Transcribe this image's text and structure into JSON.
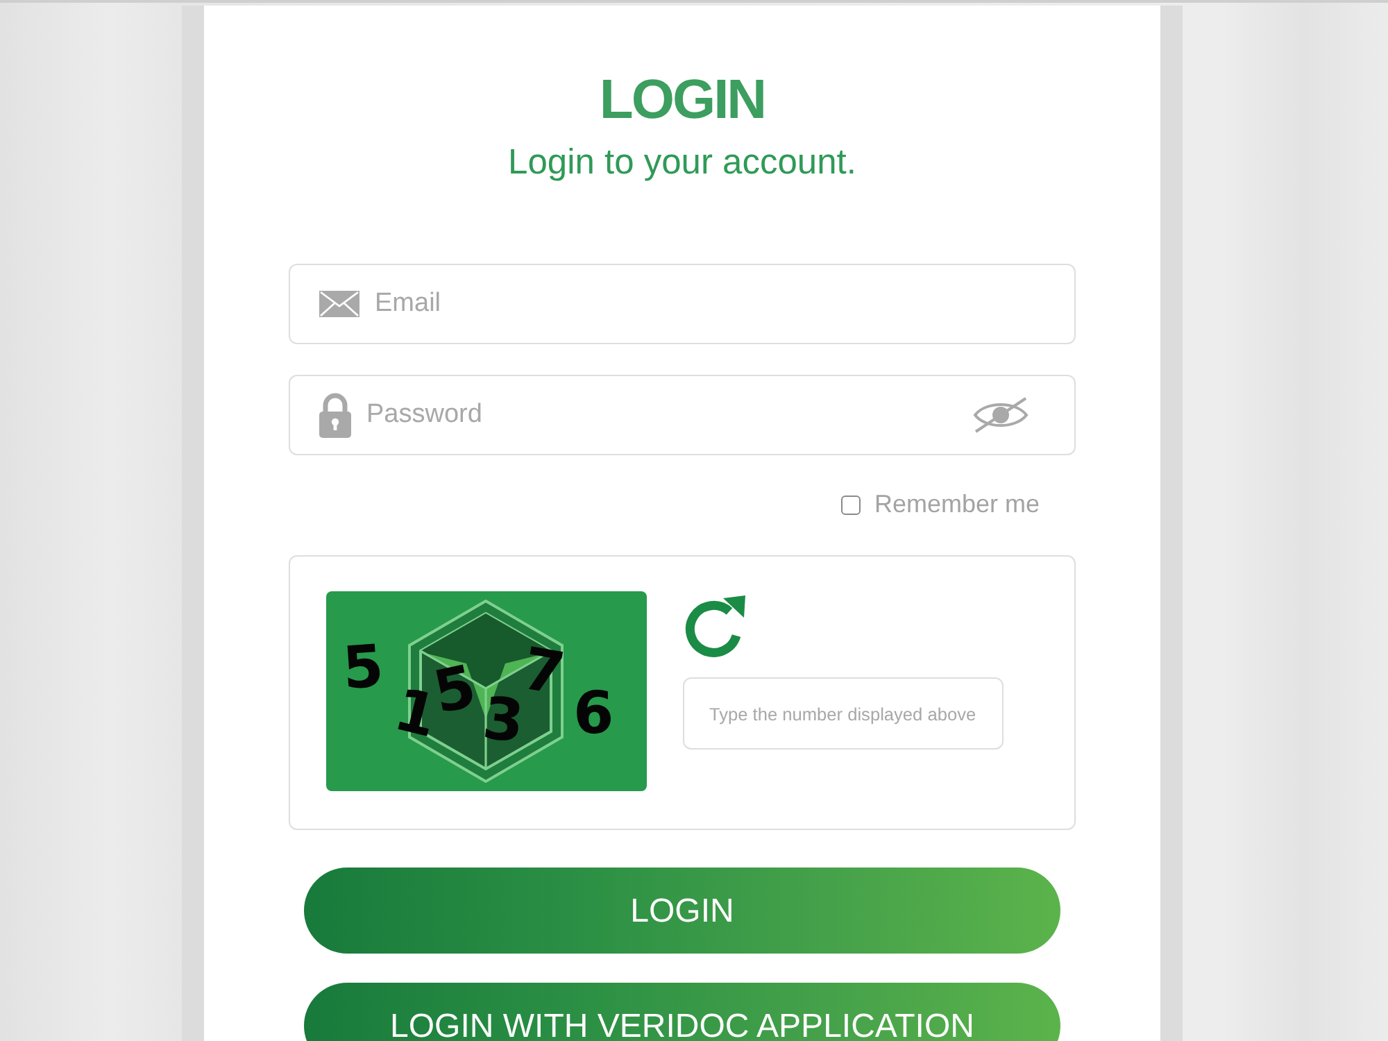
{
  "header": {
    "title": "LOGIN",
    "subtitle": "Login to your account."
  },
  "fields": [
    {
      "kind": "email",
      "placeholder": "Email"
    },
    {
      "kind": "password",
      "placeholder": "Password"
    }
  ],
  "remember_me": {
    "label": "Remember me",
    "checked": false
  },
  "captcha": {
    "digits": [
      "5",
      "1",
      "5",
      "3",
      "7",
      "6"
    ],
    "placeholder": "Type the number displayed above"
  },
  "buttons": [
    {
      "label": "LOGIN"
    },
    {
      "label": "LOGIN WITH VERIDOC APPLICATION"
    }
  ]
}
